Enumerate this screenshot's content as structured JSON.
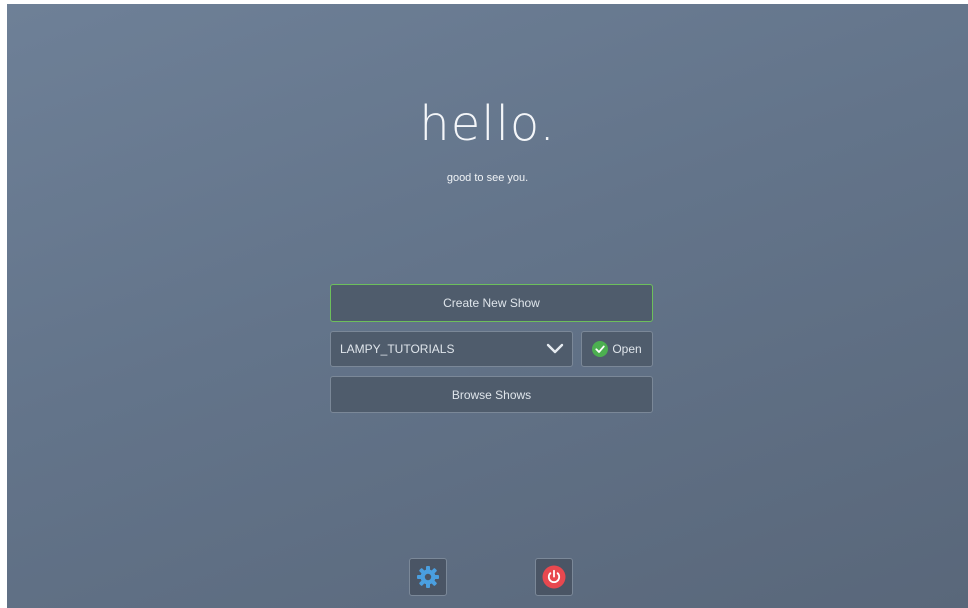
{
  "greeting": {
    "title": "hello.",
    "subtitle": "good to see you."
  },
  "actions": {
    "create_label": "Create New Show",
    "selected_show": "LAMPY_TUTORIALS",
    "open_label": "Open",
    "browse_label": "Browse Shows"
  },
  "footer": {
    "settings_icon": "gear-icon",
    "power_icon": "power-icon"
  },
  "colors": {
    "create_border": "#6dbf5c",
    "open_check": "#4caf50",
    "settings_icon": "#4a9fe0",
    "power_icon": "#e8484f"
  }
}
